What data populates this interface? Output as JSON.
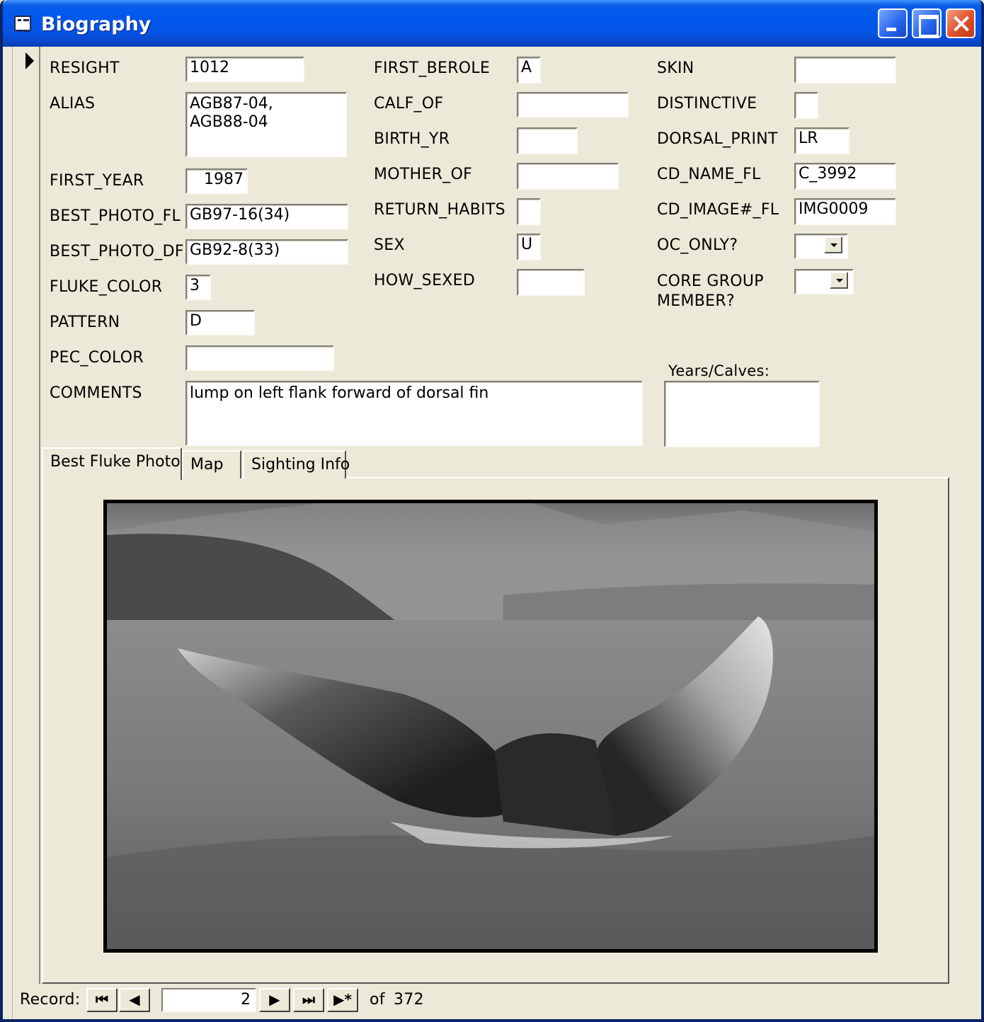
{
  "window": {
    "title": "Biography"
  },
  "fields": {
    "resight": {
      "label": "RESIGHT",
      "value": "1012"
    },
    "alias": {
      "label": "ALIAS",
      "value": "AGB87-04,\nAGB88-04"
    },
    "first_year": {
      "label": "FIRST_YEAR",
      "value": "1987"
    },
    "best_photo_fl": {
      "label": "BEST_PHOTO_FL",
      "value": "GB97-16(34)"
    },
    "best_photo_df": {
      "label": "BEST_PHOTO_DF",
      "value": "GB92-8(33)"
    },
    "fluke_color": {
      "label": "FLUKE_COLOR",
      "value": "3"
    },
    "pattern": {
      "label": "PATTERN",
      "value": "D"
    },
    "pec_color": {
      "label": "PEC_COLOR",
      "value": ""
    },
    "comments": {
      "label": "COMMENTS",
      "value": "lump on left flank forward of dorsal fin"
    },
    "first_berole": {
      "label": "FIRST_BEROLE",
      "value": "A"
    },
    "calf_of": {
      "label": "CALF_OF",
      "value": ""
    },
    "birth_yr": {
      "label": "BIRTH_YR",
      "value": ""
    },
    "mother_of": {
      "label": "MOTHER_OF",
      "value": ""
    },
    "return_habits": {
      "label": "RETURN_HABITS",
      "value": ""
    },
    "sex": {
      "label": "SEX",
      "value": "U"
    },
    "how_sexed": {
      "label": "HOW_SEXED",
      "value": ""
    },
    "skin": {
      "label": "SKIN",
      "value": ""
    },
    "distinctive": {
      "label": "DISTINCTIVE",
      "value": ""
    },
    "dorsal_print": {
      "label": "DORSAL_PRINT",
      "value": "LR"
    },
    "cd_name_fl": {
      "label": "CD_NAME_FL",
      "value": "C_3992"
    },
    "cd_image_fl": {
      "label": "CD_IMAGE#_FL",
      "value": "IMG0009"
    },
    "oc_only": {
      "label": "OC_ONLY?",
      "value": ""
    },
    "core_group_member": {
      "label": "CORE GROUP\nMEMBER?",
      "value": ""
    },
    "years_calves": {
      "label": "Years/Calves:",
      "value": ""
    }
  },
  "tabs": [
    {
      "label": "Best Fluke Photo",
      "active": true
    },
    {
      "label": "Map",
      "active": false
    },
    {
      "label": "Sighting Info",
      "active": false
    }
  ],
  "navigator": {
    "label": "Record:",
    "current": "2",
    "of_label": "of",
    "total": "372",
    "buttons": {
      "first": "first-record-icon",
      "prev": "previous-record-icon",
      "next": "next-record-icon",
      "last": "last-record-icon",
      "new": "new-record-icon"
    }
  },
  "colors": {
    "titlebar": "#0058ee",
    "window_bg": "#ece9d8",
    "close_button": "#e0502a"
  }
}
